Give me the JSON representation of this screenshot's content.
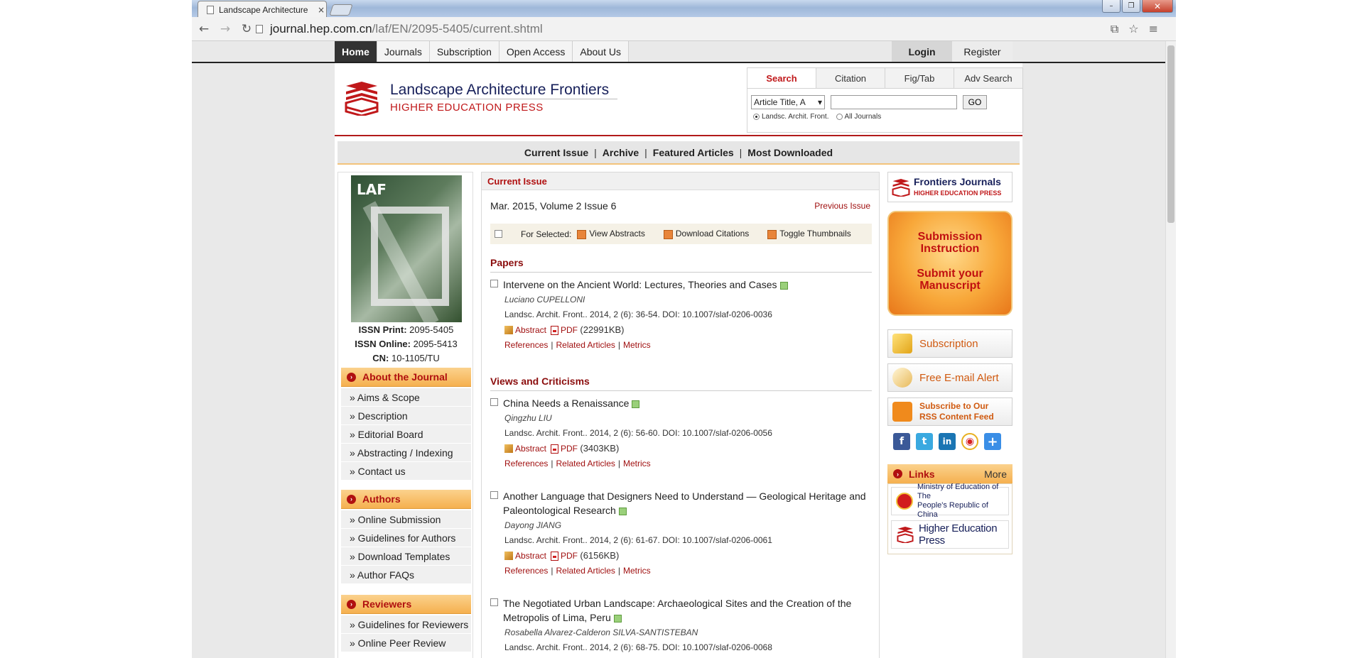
{
  "browser": {
    "tab_title": "Landscape Architecture",
    "tab_close": "×",
    "url_host": "journal.hep.com.cn",
    "url_path": "/laf/EN/2095-5405/current.shtml",
    "window_minimize": "–",
    "window_maximize": "❐",
    "window_close": "✕"
  },
  "topnav": {
    "items": [
      "Home",
      "Journals",
      "Subscription",
      "Open Access",
      "About Us"
    ],
    "login": "Login",
    "register": "Register"
  },
  "header": {
    "title": "Landscape Architecture Frontiers",
    "subtitle": "HIGHER EDUCATION PRESS"
  },
  "search": {
    "tabs": [
      "Search",
      "Citation",
      "Fig/Tab",
      "Adv Search"
    ],
    "field_select": "Article Title, A",
    "go": "GO",
    "radio_this": "Landsc. Archit. Front.",
    "radio_all": "All Journals"
  },
  "subnav": {
    "items": [
      "Current Issue",
      "Archive",
      "Featured Articles",
      "Most Downloaded"
    ],
    "sep": "|"
  },
  "left": {
    "cover_text": "LAF",
    "issn_print_label": "ISSN Print:",
    "issn_print": "2095-5405",
    "issn_online_label": "ISSN Online:",
    "issn_online": "2095-5413",
    "cn_label": "CN:",
    "cn": "10-1105/TU",
    "about_title": "About the Journal",
    "about_items": [
      "» Aims & Scope",
      "» Description",
      "» Editorial Board",
      "» Abstracting / Indexing",
      "» Contact us"
    ],
    "authors_title": "Authors",
    "authors_items": [
      "» Online Submission",
      "» Guidelines for Authors",
      "» Download Templates",
      "» Author FAQs"
    ],
    "reviewers_title": "Reviewers",
    "reviewers_items": [
      "» Guidelines for Reviewers",
      "» Online Peer Review"
    ]
  },
  "main": {
    "header": "Current Issue",
    "issue": "Mar. 2015, Volume 2 Issue 6",
    "previous": "Previous Issue",
    "for_selected": "For Selected:",
    "view_abstracts": "View Abstracts",
    "download_citations": "Download Citations",
    "toggle_thumbnails": "Toggle Thumbnails",
    "papers_title": "Papers",
    "views_title": "Views and Criticisms",
    "abstract_label": "Abstract",
    "pdf_label": "PDF",
    "references_label": "References",
    "related_label": "Related Articles",
    "metrics_label": "Metrics",
    "link_sep": "|",
    "articles": [
      {
        "title": "Intervene on the Ancient World: Lectures, Theories and Cases",
        "author": "Luciano CUPELLONI",
        "cite": "Landsc. Archit. Front.. 2014, 2 (6): 36-54.   DOI: 10.1007/slaf-0206-0036",
        "pdf_size": "(22991KB)"
      },
      {
        "title": "China Needs a Renaissance",
        "author": "Qingzhu LIU",
        "cite": "Landsc. Archit. Front.. 2014, 2 (6): 56-60.   DOI: 10.1007/slaf-0206-0056",
        "pdf_size": "(3403KB)"
      },
      {
        "title": "Another Language that Designers Need to Understand — Geological Heritage and Paleontological Research",
        "author": "Dayong JIANG",
        "cite": "Landsc. Archit. Front.. 2014, 2 (6): 61-67.   DOI: 10.1007/slaf-0206-0061",
        "pdf_size": "(6156KB)"
      },
      {
        "title": "The Negotiated Urban Landscape: Archaeological Sites and the Creation of the Metropolis of Lima, Peru",
        "author": "Rosabella Alvarez-Calderon SILVA-SANTISTEBAN",
        "cite": "Landsc. Archit. Front.. 2014, 2 (6): 68-75.   DOI: 10.1007/slaf-0206-0068"
      }
    ]
  },
  "right": {
    "fj_title": "Frontiers Journals",
    "fj_sub": "HIGHER EDUCATION PRESS",
    "submission_a1": "Submission",
    "submission_a2": "Instruction",
    "submission_b1": "Submit your",
    "submission_b2": "Manuscript",
    "subscription": "Subscription",
    "email_alert": "Free E-mail Alert",
    "rss_1": "Subscribe to Our",
    "rss_2": "RSS Content Feed",
    "social_icons": [
      "facebook-icon",
      "twitter-icon",
      "linkedin-icon",
      "weibo-icon",
      "share-plus-icon"
    ],
    "links_title": "Links",
    "links_more": "More",
    "moe_1": "Ministry of Education of The",
    "moe_2": "People's Republic of China",
    "hep": "Higher Education Press"
  },
  "colors": {
    "accent_red": "#c0181a",
    "navy": "#17205a",
    "sidebar_orange": "#f5b04f"
  }
}
